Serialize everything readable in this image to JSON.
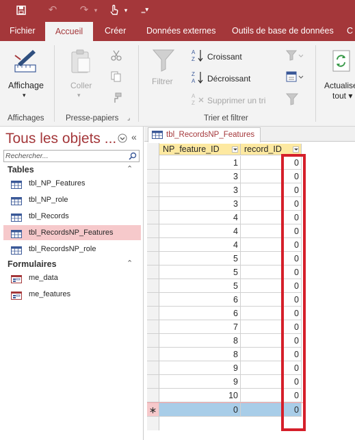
{
  "quick_access": {
    "icons": [
      "save-icon",
      "undo-icon",
      "redo-icon",
      "touch-mode-icon",
      "customize-qat-icon"
    ]
  },
  "tabs": [
    "Fichier",
    "Accueil",
    "Créer",
    "Données externes",
    "Outils de base de données"
  ],
  "active_tab": "Accueil",
  "ribbon": {
    "affichage_label": "Affichage",
    "affichage_group": "Affichages",
    "coller_label": "Coller",
    "pressepapiers_group": "Presse-papiers",
    "filtrer_label": "Filtrer",
    "croissant_label": "Croissant",
    "decroissant_label": "Décroissant",
    "supprimer_tri_label": "Supprimer un tri",
    "trier_group": "Trier et filtrer",
    "actualiser_label": "Actualise",
    "actualiser_label2": "tout ▾"
  },
  "nav": {
    "title": "Tous les objets ...",
    "search_placeholder": "Rechercher...",
    "sections": [
      {
        "label": "Tables",
        "items": [
          "tbl_NP_Features",
          "tbl_NP_role",
          "tbl_Records",
          "tbl_RecordsNP_Features",
          "tbl_RecordsNP_role"
        ]
      },
      {
        "label": "Formulaires",
        "items": [
          "me_data",
          "me_features"
        ]
      }
    ],
    "selected_item": "tbl_RecordsNP_Features"
  },
  "document": {
    "tab_title": "tbl_RecordsNP_Features",
    "columns": [
      "NP_feature_ID",
      "record_ID"
    ],
    "rows": [
      [
        "1",
        "0"
      ],
      [
        "3",
        "0"
      ],
      [
        "3",
        "0"
      ],
      [
        "3",
        "0"
      ],
      [
        "4",
        "0"
      ],
      [
        "4",
        "0"
      ],
      [
        "4",
        "0"
      ],
      [
        "5",
        "0"
      ],
      [
        "5",
        "0"
      ],
      [
        "5",
        "0"
      ],
      [
        "6",
        "0"
      ],
      [
        "6",
        "0"
      ],
      [
        "7",
        "0"
      ],
      [
        "8",
        "0"
      ],
      [
        "8",
        "0"
      ],
      [
        "9",
        "0"
      ],
      [
        "9",
        "0"
      ],
      [
        "10",
        "0"
      ]
    ],
    "new_row": [
      "0",
      "0"
    ],
    "new_row_marker": "∗"
  },
  "colors": {
    "brand": "#a4373a",
    "header_fill": "#fde9a1",
    "selected_nav": "#f6c9cb",
    "new_row": "#a8cde8",
    "highlight_box": "#d51f2a"
  }
}
